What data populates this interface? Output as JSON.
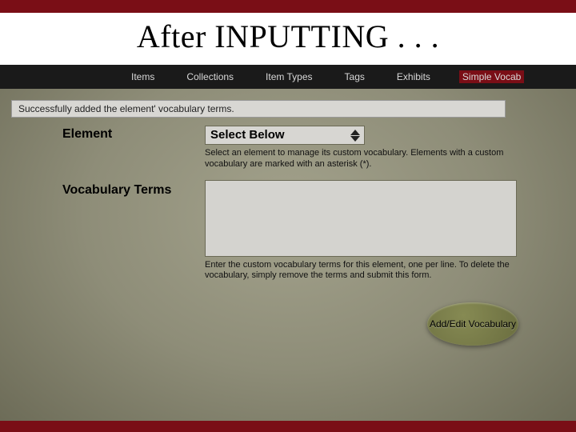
{
  "title": "After INPUTTING . . .",
  "nav": {
    "items": "Items",
    "collections": "Collections",
    "item_types": "Item Types",
    "tags": "Tags",
    "exhibits": "Exhibits",
    "simple_vocab": "Simple Vocab"
  },
  "flash": "Successfully added the element' vocabulary terms.",
  "form": {
    "element_label": "Element",
    "element_select": "Select Below",
    "element_help": "Select an element to manage its custom vocabulary. Elements with a custom vocabulary are marked with an asterisk (*).",
    "vocab_label": "Vocabulary Terms",
    "vocab_value": "",
    "vocab_help": "Enter the custom vocabulary terms for this element, one per line. To delete the vocabulary, simply remove the terms and submit this form."
  },
  "button": "Add/Edit Vocabulary"
}
